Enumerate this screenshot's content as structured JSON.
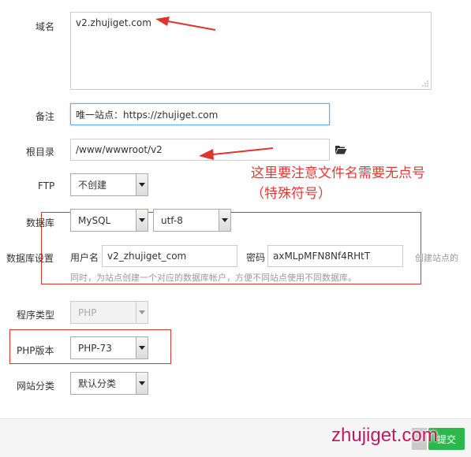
{
  "form": {
    "domain": {
      "label": "域名",
      "value": "v2.zhujiget.com"
    },
    "remark": {
      "label": "备注",
      "value": "唯一站点：https://zhujiget.com"
    },
    "root": {
      "label": "根目录",
      "value": "/www/wwwroot/v2",
      "icon": "folder-open-icon"
    },
    "ftp": {
      "label": "FTP",
      "value": "不创建"
    },
    "database": {
      "label": "数据库",
      "type_value": "MySQL",
      "charset_value": "utf-8"
    },
    "db_settings": {
      "label": "数据库设置",
      "user_label": "用户名",
      "user_value": "v2_zhujiget_com",
      "password_label": "密码",
      "password_value": "axMLpMFN8Nf4RHtT",
      "hint_line1": "创建站点的",
      "hint_line2": "同时，为站点创建一个对应的数据库帐户，方便不同站点使用不同数据库。"
    },
    "program_type": {
      "label": "程序类型",
      "value": "PHP"
    },
    "php_version": {
      "label": "PHP版本",
      "value": "PHP-73"
    },
    "site_category": {
      "label": "网站分类",
      "value": "默认分类"
    }
  },
  "annotation": {
    "line1": "这里要注意文件名需要无点号",
    "line2": "（特殊符号）",
    "color": "#e53935"
  },
  "footer": {
    "watermark": "zhujiget.com",
    "submit_label": "提交",
    "submit_color": "#2db84d"
  }
}
